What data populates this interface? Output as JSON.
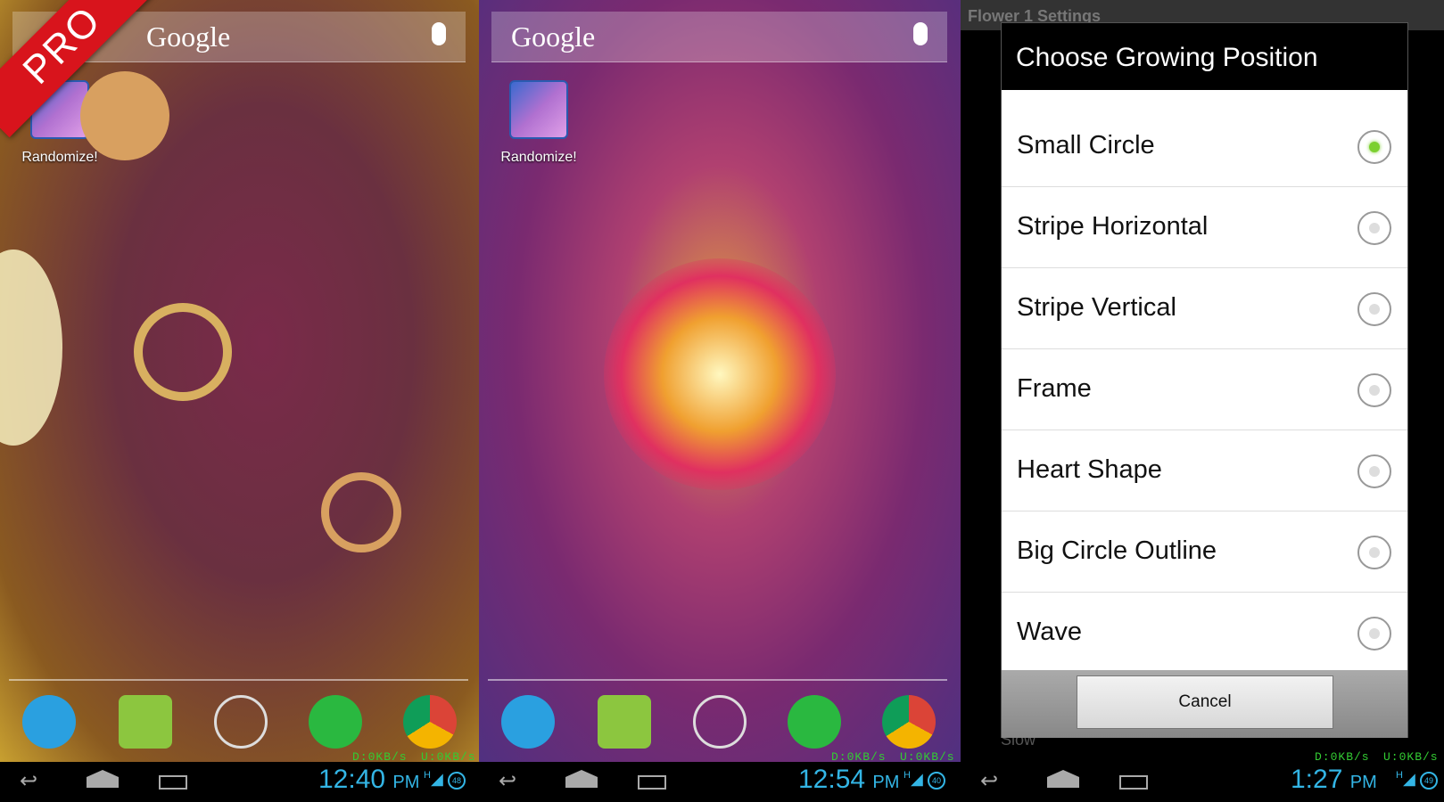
{
  "badge": "PRO",
  "colors": {
    "accent": "#33b5e5",
    "speed": "#33cc33",
    "radio_selected": "#7cd030",
    "badge": "#d8141c"
  },
  "screens": [
    {
      "search": "Google",
      "app_label": "Randomize!",
      "speed_down": "D:0KB/s",
      "speed_up": "U:0KB/s",
      "time": "12:40",
      "ampm": "PM",
      "signal": "H",
      "battery": "48"
    },
    {
      "search": "Google",
      "app_label": "Randomize!",
      "speed_down": "D:0KB/s",
      "speed_up": "U:0KB/s",
      "time": "12:54",
      "ampm": "PM",
      "signal": "H",
      "battery": "40"
    },
    {
      "speed_down": "D:0KB/s",
      "speed_up": "U:0KB/s",
      "time": "1:27",
      "ampm": "PM",
      "signal": "H",
      "battery": "49"
    }
  ],
  "settings": {
    "title": "Flower 1 Settings",
    "background_hint": "Slow"
  },
  "dialog": {
    "title": "Choose Growing Position",
    "options": [
      {
        "label": "Small Circle",
        "selected": true
      },
      {
        "label": "Stripe Horizontal",
        "selected": false
      },
      {
        "label": "Stripe Vertical",
        "selected": false
      },
      {
        "label": "Frame",
        "selected": false
      },
      {
        "label": "Heart Shape",
        "selected": false
      },
      {
        "label": "Big Circle Outline",
        "selected": false
      },
      {
        "label": "Wave",
        "selected": false
      }
    ],
    "cancel": "Cancel"
  },
  "icons": [
    "back-icon",
    "home-icon",
    "recent-apps-icon",
    "phone-icon",
    "messaging-icon",
    "app-drawer-icon",
    "whatsapp-icon",
    "chrome-icon",
    "mic-icon"
  ]
}
